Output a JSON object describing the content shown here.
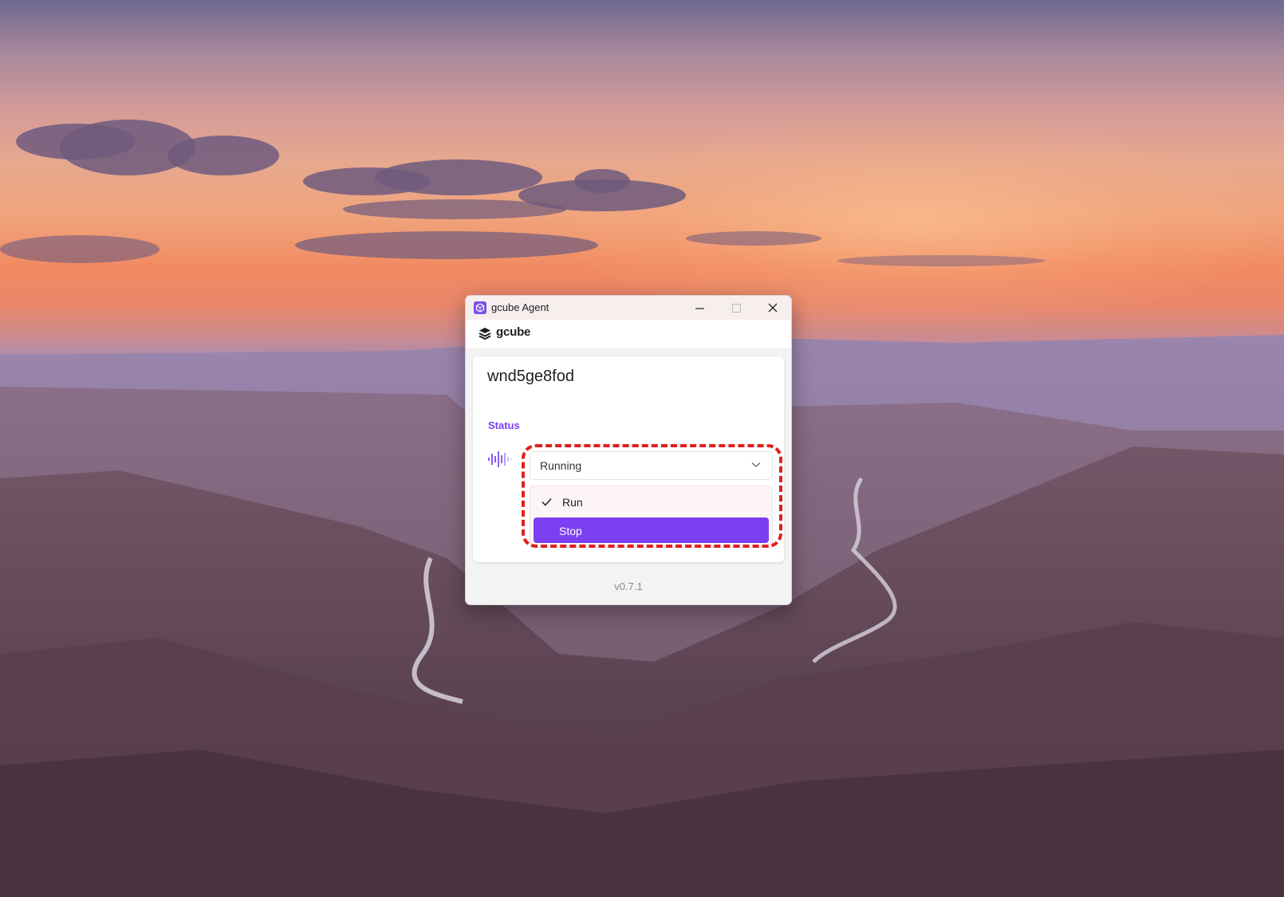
{
  "window": {
    "title": "gcube Agent",
    "brand": "gcube"
  },
  "agent": {
    "name": "wnd5ge8fod"
  },
  "status": {
    "label": "Status",
    "selected": "Running",
    "options": [
      {
        "label": "Run",
        "checked": true
      },
      {
        "label": "Stop",
        "highlighted": true
      }
    ]
  },
  "footer": {
    "version": "v0.7.1"
  },
  "colors": {
    "accent": "#7a3ff0",
    "highlight_annotation": "#e01e1e"
  }
}
